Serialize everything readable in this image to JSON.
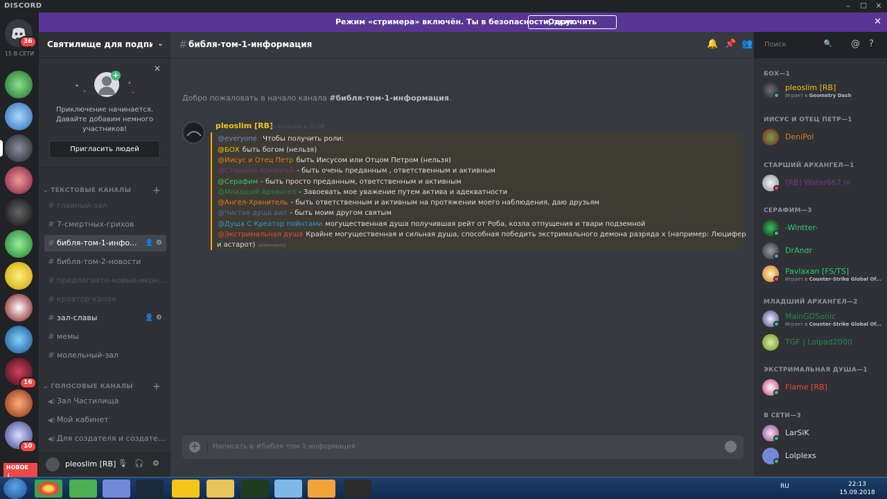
{
  "titlebar": {
    "brand": "DISCORD",
    "minimize": "–",
    "maximize": "☐",
    "close": "✕"
  },
  "guilds": {
    "online": "15 В СЕТИ",
    "home_badge": "36",
    "badges": {
      "b16": "16",
      "b10": "10"
    },
    "new_label": "НОВОЕ ↓"
  },
  "banner": {
    "text": "Режим «стримера» включён. Ты в безопасности, друг.",
    "button": "Отключить",
    "close": "✕"
  },
  "server": {
    "name": "Святилище для подписчи...",
    "invite": {
      "message": "Приключение начинается. Давайте добавим немного участников!",
      "button": "Пригласить людей"
    },
    "text_category": "ТЕКСТОВЫЕ КАНАЛЫ",
    "voice_category": "ГОЛОСОВЫЕ КАНАЛЫ",
    "text_channels": [
      {
        "name": "главный-зал"
      },
      {
        "name": "7-смертных-грихов"
      },
      {
        "name": "библя-том-1-инфо..."
      },
      {
        "name": "библя-том-2-новости"
      },
      {
        "name": "предлагайте-новый-икон..."
      },
      {
        "name": "креатор-канал"
      },
      {
        "name": "зал-славы"
      },
      {
        "name": "мемы"
      },
      {
        "name": "молельный-зал"
      }
    ],
    "voice_channels": [
      {
        "name": "Зал Частилища"
      },
      {
        "name": "Мой кабинет"
      },
      {
        "name": "Для создателя и создате..."
      }
    ]
  },
  "user": {
    "name": "pleoslim [RB]"
  },
  "channel": {
    "name": "библя-том-1-информация",
    "search_placeholder": "Поиск",
    "welcome_prefix": "Добро пожаловать в начало канала ",
    "welcome_channel": "#библя-том-1-информация",
    "welcome_suffix": "."
  },
  "message": {
    "author": "pleoslim [RB]",
    "time": "Во вторник в 20:08",
    "lines": [
      {
        "role": "",
        "text": "Чтобы получить роли:"
      },
      {
        "role": "@everyone",
        "text": ""
      },
      {
        "role": "@БОХ",
        "text": " быть богом (нельзя)"
      },
      {
        "role": "@Иисус и Отец Петр",
        "text": " быть Иисусом или Отцом Петром (нельзя)"
      },
      {
        "role": "@Старший Архангел",
        "text": " - быть очень преданным , ответственным и активным"
      },
      {
        "role": "@Серафим",
        "text": " - быть просто преданным, ответственным и  активным"
      },
      {
        "role": "@Младший Архангел",
        "text": " - Завоевать мое уважение путем актива и адекватности"
      },
      {
        "role": "@Ангел-Хранитель",
        "text": " - быть ответственным и активным на протяжении моего наблюдения, даю друзьям"
      },
      {
        "role": "@Чистая душа вип",
        "text": " - быть моим другом святым"
      },
      {
        "role": "@Душа С Креатор пойнтами",
        "text": " могущественная душа получившая рейт от Роба, козла отпущения и твари подземной"
      },
      {
        "role": "@Экстримальная душа",
        "text": " Крайне могущественная и сильная душа, способная победить экстримального демона разряда х (например: Люцифер"
      },
      {
        "role": "",
        "text": "и астарот)"
      }
    ],
    "edited": "(изменено)",
    "colors": {
      "everyone": "#7289da",
      "boh": "#f1c40f",
      "iisus": "#e67e22",
      "starshiy": "#71368a",
      "serafim": "#2ecc71",
      "mladshiy": "#1f8b4c",
      "angel": "#e67e22",
      "chistaya": "#4a6ba8",
      "creator": "#3498db",
      "extreme": "#e74c3c"
    }
  },
  "composer": {
    "placeholder": "Написать в #библя-том-1-информация"
  },
  "members": {
    "groups": [
      {
        "title": "БОХ—1"
      },
      {
        "title": "ИИСУС И ОТЕЦ ПЕТР—1"
      },
      {
        "title": "СТАРШИЙ АРХАНГЕЛ—1"
      },
      {
        "title": "СЕРАФИМ—3"
      },
      {
        "title": "МЛАДШИЙ АРХАНГЕЛ—2"
      },
      {
        "title": "ЭКСТРИМАЛЬНАЯ ДУША—1"
      },
      {
        "title": "В СЕТИ—3"
      }
    ],
    "list": [
      {
        "name": "pleoslim [RB]",
        "activity_prefix": "Играет в ",
        "activity": "Geometry Dash",
        "color": "#f1c40f"
      },
      {
        "name": "DeniPol",
        "color": "#e67e22"
      },
      {
        "name": "[RB] Water667",
        "tag": "FR",
        "color": "#71368a"
      },
      {
        "name": "-Wintter-",
        "color": "#2ecc71"
      },
      {
        "name": "DrAndr",
        "color": "#2ecc71"
      },
      {
        "name": "Pavlaxan [FS/TS]",
        "activity_prefix": "Играет в ",
        "activity": "Counter-Strike Global Of...",
        "color": "#2ecc71"
      },
      {
        "name": "MainGDSonic",
        "activity_prefix": "Играет в ",
        "activity": "Counter-Strike Global Of...",
        "color": "#1f8b4c"
      },
      {
        "name": "TGF | Lolpad2000",
        "color": "#1f8b4c"
      },
      {
        "name": "Flame [RB]",
        "color": "#e74c3c"
      },
      {
        "name": "LarSiK",
        "color": "#dcddde"
      },
      {
        "name": "Lolplexs",
        "color": "#dcddde"
      }
    ]
  },
  "taskbar": {
    "lang": "RU",
    "time": "22:13",
    "date": "15.09.2018"
  }
}
